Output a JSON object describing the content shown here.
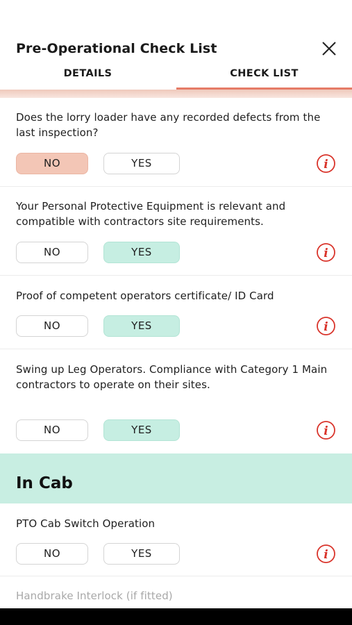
{
  "header": {
    "title": "Pre-Operational Check List",
    "close_icon": "close-icon"
  },
  "tabs": [
    {
      "label": "DETAILS",
      "active": false
    },
    {
      "label": "CHECK LIST",
      "active": true
    }
  ],
  "questions": [
    {
      "text": "Does the lorry loader have any recorded defects from the last inspection?",
      "no_label": "NO",
      "yes_label": "YES",
      "selected": "NO"
    },
    {
      "text": "Your Personal Protective Equipment is relevant and compatible with contractors site requirements.",
      "no_label": "NO",
      "yes_label": "YES",
      "selected": "YES"
    },
    {
      "text": "Proof of competent operators certificate/ ID Card",
      "no_label": "NO",
      "yes_label": "YES",
      "selected": "YES"
    },
    {
      "text": "Swing up Leg Operators. Compliance with Category 1 Main contractors to operate on their sites.",
      "no_label": "NO",
      "yes_label": "YES",
      "selected": "YES"
    }
  ],
  "section": {
    "title": "In Cab",
    "questions": [
      {
        "text": "PTO Cab Switch Operation",
        "no_label": "NO",
        "yes_label": "YES",
        "selected": ""
      },
      {
        "text": "Handbrake Interlock (if fitted)"
      }
    ]
  },
  "icons": {
    "info": "info-icon"
  },
  "colors": {
    "accent": "#e57b66",
    "no_selected": "#f3c6b6",
    "yes_selected": "#c6eee2",
    "section_bg": "#c8eee2",
    "info_icon": "#d9342b"
  }
}
